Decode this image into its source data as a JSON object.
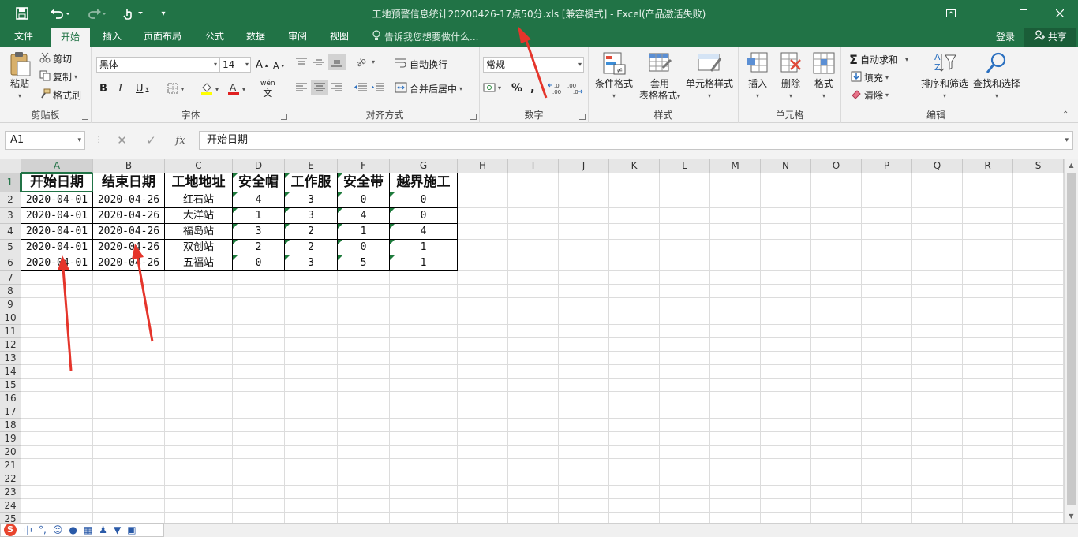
{
  "titlebar": {
    "title": "工地预警信息统计20200426-17点50分.xls  [兼容模式] - Excel(产品激活失败)",
    "save_icon": "save-icon",
    "undo_icon": "undo-icon",
    "redo_icon": "redo-icon",
    "touch_icon": "touch-mode-icon"
  },
  "tabs": [
    "文件",
    "开始",
    "插入",
    "页面布局",
    "公式",
    "数据",
    "审阅",
    "视图"
  ],
  "active_tab": "开始",
  "tell_me": "告诉我您想要做什么...",
  "account": {
    "login": "登录",
    "share": "共享"
  },
  "ribbon": {
    "clipboard": {
      "label": "剪贴板",
      "paste": "粘贴",
      "cut": "剪切",
      "copy": "复制",
      "format_painter": "格式刷"
    },
    "font": {
      "label": "字体",
      "name": "黑体",
      "size": "14",
      "bold": "B",
      "italic": "I",
      "underline": "U",
      "wen": "wén",
      "wen2": "文"
    },
    "alignment": {
      "label": "对齐方式",
      "wrap": "自动换行",
      "merge": "合并后居中"
    },
    "number": {
      "label": "数字",
      "format": "常规",
      "percent": "%",
      "comma": ",",
      "inc": "←.0 .00",
      "dec": ".00 →.0"
    },
    "styles": {
      "label": "样式",
      "conditional": "条件格式",
      "table": "套用\n表格格式",
      "cell_styles": "单元格样式",
      "table_line1": "套用",
      "table_line2": "表格格式"
    },
    "cells": {
      "label": "单元格",
      "insert": "插入",
      "delete": "删除",
      "format": "格式"
    },
    "editing": {
      "label": "编辑",
      "autosum": "自动求和",
      "fill": "填充",
      "clear": "清除",
      "sort": "排序和筛选",
      "find": "查找和选择"
    }
  },
  "formula_bar": {
    "name_box": "A1",
    "cancel": "✕",
    "enter": "✓",
    "fx": "fx",
    "content": "开始日期"
  },
  "grid": {
    "columns": [
      "A",
      "B",
      "C",
      "D",
      "E",
      "F",
      "G",
      "H",
      "I",
      "J",
      "K",
      "L",
      "M",
      "N",
      "O",
      "P",
      "Q",
      "R",
      "S"
    ],
    "rows": [
      "1",
      "2",
      "3",
      "4",
      "5",
      "6",
      "7",
      "8",
      "9",
      "10",
      "11",
      "12",
      "13",
      "14",
      "15",
      "16",
      "17",
      "18",
      "19",
      "20",
      "21",
      "22",
      "23",
      "24",
      "25"
    ],
    "header": [
      "开始日期",
      "结束日期",
      "工地地址",
      "安全帽",
      "工作服",
      "安全带",
      "越界施工"
    ],
    "data": [
      [
        "2020-04-01",
        "2020-04-26",
        "红石站",
        "4",
        "3",
        "0",
        "0"
      ],
      [
        "2020-04-01",
        "2020-04-26",
        "大洋站",
        "1",
        "3",
        "4",
        "0"
      ],
      [
        "2020-04-01",
        "2020-04-26",
        "福岛站",
        "3",
        "2",
        "1",
        "4"
      ],
      [
        "2020-04-01",
        "2020-04-26",
        "双创站",
        "2",
        "2",
        "0",
        "1"
      ],
      [
        "2020-04-01",
        "2020-04-26",
        "五福站",
        "0",
        "3",
        "5",
        "1"
      ]
    ],
    "selected_cell": "A1"
  },
  "ime": {
    "logo": "S",
    "mode": "中"
  },
  "colors": {
    "accent": "#217346",
    "annotation": "#e5352b"
  }
}
